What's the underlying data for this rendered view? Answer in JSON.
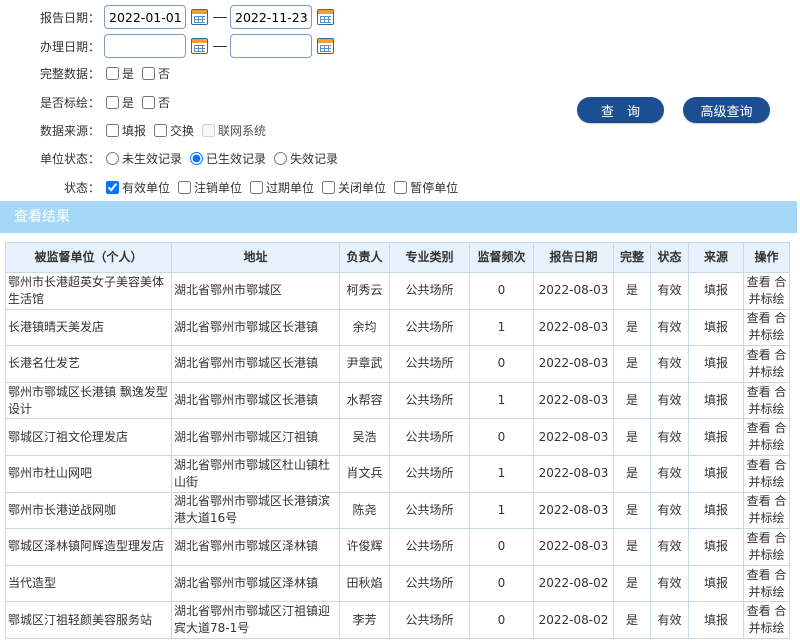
{
  "filters": {
    "report_date": {
      "label": "报告日期：",
      "from": "2022-01-01",
      "to": "2022-11-23"
    },
    "handle_date": {
      "label": "办理日期：",
      "from": "",
      "to": ""
    },
    "complete_data": {
      "label": "完整数据：",
      "yes": "是",
      "no": "否"
    },
    "is_marked": {
      "label": "是否标绘：",
      "yes": "是",
      "no": "否"
    },
    "data_source": {
      "label": "数据来源：",
      "opt1": "填报",
      "opt2": "交换",
      "opt3": "联网系统"
    },
    "unit_status": {
      "label": "单位状态：",
      "opt1": "未生效记录",
      "opt2": "已生效记录",
      "opt3": "失效记录"
    },
    "status": {
      "label": "状态：",
      "opt1": "有效单位",
      "opt2": "注销单位",
      "opt3": "过期单位",
      "opt4": "关闭单位",
      "opt5": "暂停单位"
    }
  },
  "buttons": {
    "query": "查　询",
    "advanced_query": "高级查询"
  },
  "results": {
    "title": "查看结果",
    "columns": [
      "被监督单位（个人）",
      "地址",
      "负责人",
      "专业类别",
      "监督频次",
      "报告日期",
      "完整",
      "状态",
      "来源",
      "操作"
    ],
    "rows": [
      {
        "unit": "鄂州市长港超英女子美容美体生活馆",
        "address": "湖北省鄂州市鄂城区",
        "person": "柯秀云",
        "category": "公共场所",
        "freq": "0",
        "date": "2022-08-03",
        "complete": "是",
        "state": "有效",
        "source": "填报",
        "op_view": "查看",
        "op_merge": "合并",
        "op_mark": "标绘"
      },
      {
        "unit": "长港镇晴天美发店",
        "address": "湖北省鄂州市鄂城区长港镇",
        "person": "余均",
        "category": "公共场所",
        "freq": "1",
        "date": "2022-08-03",
        "complete": "是",
        "state": "有效",
        "source": "填报",
        "op_view": "查看",
        "op_merge": "合并",
        "op_mark": "标绘"
      },
      {
        "unit": "长港名仕发艺",
        "address": "湖北省鄂州市鄂城区长港镇",
        "person": "尹章武",
        "category": "公共场所",
        "freq": "0",
        "date": "2022-08-03",
        "complete": "是",
        "state": "有效",
        "source": "填报",
        "op_view": "查看",
        "op_merge": "合并",
        "op_mark": "标绘"
      },
      {
        "unit": "鄂州市鄂城区长港镇 飘逸发型设计",
        "address": "湖北省鄂州市鄂城区长港镇",
        "person": "水帮容",
        "category": "公共场所",
        "freq": "1",
        "date": "2022-08-03",
        "complete": "是",
        "state": "有效",
        "source": "填报",
        "op_view": "查看",
        "op_merge": "合并",
        "op_mark": "标绘"
      },
      {
        "unit": "鄂城区汀祖文伦理发店",
        "address": "湖北省鄂州市鄂城区汀祖镇",
        "person": "吴浩",
        "category": "公共场所",
        "freq": "0",
        "date": "2022-08-03",
        "complete": "是",
        "state": "有效",
        "source": "填报",
        "op_view": "查看",
        "op_merge": "合并",
        "op_mark": "标绘"
      },
      {
        "unit": "鄂州市杜山网吧",
        "address": "湖北省鄂州市鄂城区杜山镇杜山街",
        "person": "肖文兵",
        "category": "公共场所",
        "freq": "1",
        "date": "2022-08-03",
        "complete": "是",
        "state": "有效",
        "source": "填报",
        "op_view": "查看",
        "op_merge": "合并",
        "op_mark": "标绘"
      },
      {
        "unit": "鄂州市长港逆战网咖",
        "address": "湖北省鄂州市鄂城区长港镇滨港大道16号",
        "person": "陈尧",
        "category": "公共场所",
        "freq": "1",
        "date": "2022-08-03",
        "complete": "是",
        "state": "有效",
        "source": "填报",
        "op_view": "查看",
        "op_merge": "合并",
        "op_mark": "标绘"
      },
      {
        "unit": "鄂城区泽林镇阿辉造型理发店",
        "address": "湖北省鄂州市鄂城区泽林镇",
        "person": "许俊辉",
        "category": "公共场所",
        "freq": "0",
        "date": "2022-08-03",
        "complete": "是",
        "state": "有效",
        "source": "填报",
        "op_view": "查看",
        "op_merge": "合并",
        "op_mark": "标绘"
      },
      {
        "unit": "当代造型",
        "address": "湖北省鄂州市鄂城区泽林镇",
        "person": "田秋焰",
        "category": "公共场所",
        "freq": "0",
        "date": "2022-08-02",
        "complete": "是",
        "state": "有效",
        "source": "填报",
        "op_view": "查看",
        "op_merge": "合并",
        "op_mark": "标绘"
      },
      {
        "unit": "鄂城区汀祖轻颜美容服务站",
        "address": "湖北省鄂州市鄂城区汀祖镇迎宾大道78-1号",
        "person": "李芳",
        "category": "公共场所",
        "freq": "0",
        "date": "2022-08-02",
        "complete": "是",
        "state": "有效",
        "source": "填报",
        "op_view": "查看",
        "op_merge": "合并",
        "op_mark": "标绘"
      }
    ]
  }
}
